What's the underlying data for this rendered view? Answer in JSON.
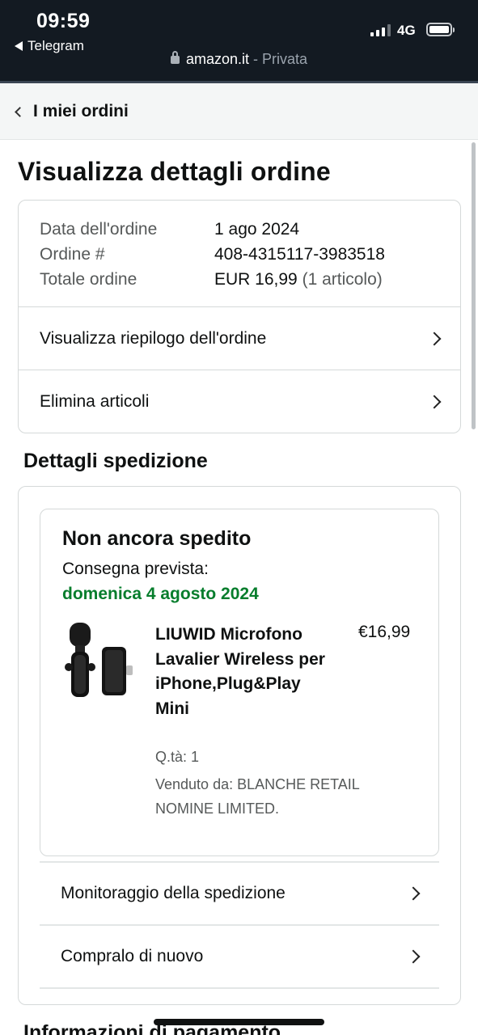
{
  "status_bar": {
    "time": "09:59",
    "back_app": "Telegram",
    "network": "4G"
  },
  "browser": {
    "domain": "amazon.it",
    "separator": " - ",
    "mode": "Privata"
  },
  "nav": {
    "back_label": "I miei ordini"
  },
  "page": {
    "title": "Visualizza dettagli ordine"
  },
  "order": {
    "date_label": "Data dell'ordine",
    "date_value": "1 ago 2024",
    "number_label": "Ordine #",
    "number_value": "408-4315117-3983518",
    "total_label": "Totale ordine",
    "total_value": "EUR 16,99",
    "total_items": "(1 articolo)",
    "links": [
      {
        "label": "Visualizza riepilogo dell'ordine"
      },
      {
        "label": "Elimina articoli"
      }
    ]
  },
  "shipment": {
    "section_title": "Dettagli spedizione",
    "status": "Non ancora spedito",
    "delivery_label": "Consegna prevista:",
    "delivery_date": "domenica 4 agosto 2024",
    "delivery_color": "#067d2c",
    "product": {
      "name": "LIUWID Microfono Lavalier Wireless per iPhone,Plug&Play Mini",
      "price": "€16,99",
      "quantity": "Q.tà: 1",
      "seller": "Venduto da: BLANCHE RETAIL NOMINE LIMITED.",
      "image_icon": "wireless-microphone-product-image"
    },
    "actions": [
      {
        "label": "Monitoraggio della spedizione"
      },
      {
        "label": "Compralo di nuovo"
      }
    ]
  },
  "payment": {
    "section_title": "Informazioni di pagamento"
  }
}
